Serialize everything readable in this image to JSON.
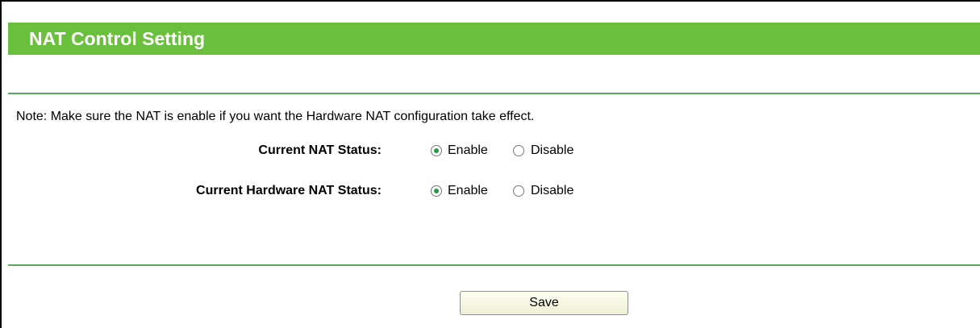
{
  "header": {
    "title": "NAT Control Setting"
  },
  "note": "Note: Make sure the NAT is enable if you want the Hardware NAT configuration take effect.",
  "settings": [
    {
      "label": "Current NAT Status:",
      "options": [
        {
          "label": "Enable",
          "checked": true
        },
        {
          "label": "Disable",
          "checked": false
        }
      ]
    },
    {
      "label": "Current Hardware NAT Status:",
      "options": [
        {
          "label": "Enable",
          "checked": true
        },
        {
          "label": "Disable",
          "checked": false
        }
      ]
    }
  ],
  "save_label": "Save",
  "colors": {
    "header_bg": "#6ac03c",
    "divider": "#5aa860",
    "radio_dot": "#1f9a44"
  }
}
